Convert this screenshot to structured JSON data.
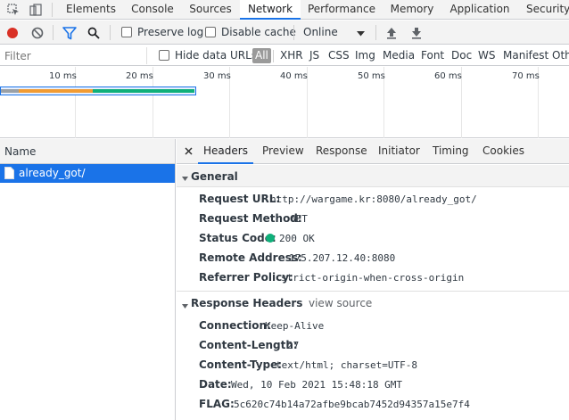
{
  "tabs": {
    "items": [
      "Elements",
      "Console",
      "Sources",
      "Network",
      "Performance",
      "Memory",
      "Application",
      "Security"
    ],
    "active": "Network"
  },
  "toolbar": {
    "preserve_log": "Preserve log",
    "disable_cache": "Disable cache",
    "throttle": "Online"
  },
  "filter": {
    "placeholder": "Filter",
    "hide_data_urls": "Hide data URLs",
    "types": [
      "All",
      "XHR",
      "JS",
      "CSS",
      "Img",
      "Media",
      "Font",
      "Doc",
      "WS",
      "Manifest",
      "Oth"
    ]
  },
  "timeline": {
    "ticks": [
      "10 ms",
      "20 ms",
      "30 ms",
      "40 ms",
      "50 ms",
      "60 ms",
      "70 ms"
    ],
    "colors": {
      "waiting": "#f29c33",
      "download": "#0fb07a",
      "frame": "#1a73e8",
      "queued": "#9aa0a6"
    }
  },
  "requests": {
    "column_name": "Name",
    "items": [
      "already_got/"
    ]
  },
  "details": {
    "tabs": [
      "Headers",
      "Preview",
      "Response",
      "Initiator",
      "Timing",
      "Cookies"
    ],
    "active": "Headers",
    "general": {
      "title": "General",
      "request_url_key": "Request URL:",
      "request_url": "http://wargame.kr:8080/already_got/",
      "request_method_key": "Request Method:",
      "request_method": "GET",
      "status_code_key": "Status Code:",
      "status_code": "200 OK",
      "status_color": "#0fb07a",
      "remote_address_key": "Remote Address:",
      "remote_address": "175.207.12.40:8080",
      "referrer_policy_key": "Referrer Policy:",
      "referrer_policy": "strict-origin-when-cross-origin"
    },
    "response_headers": {
      "title": "Response Headers",
      "view_source": "view source",
      "connection_key": "Connection:",
      "connection": "Keep-Alive",
      "content_length_key": "Content-Length:",
      "content_length": "27",
      "content_type_key": "Content-Type:",
      "content_type": "text/html; charset=UTF-8",
      "date_key": "Date:",
      "date": "Wed, 10 Feb 2021 15:48:18 GMT",
      "flag_key": "FLAG:",
      "flag": "5c620c74b14a72afbe9bcab7452d94357a15e7f4"
    }
  }
}
